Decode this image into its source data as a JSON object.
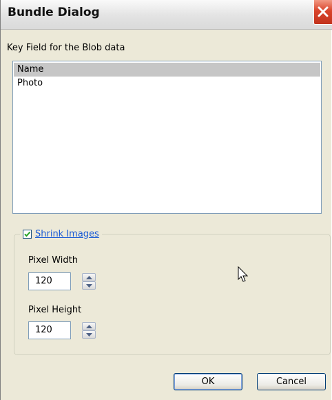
{
  "window": {
    "title": "Bundle Dialog"
  },
  "key_field": {
    "label": "Key Field for the Blob data",
    "items": [
      {
        "label": "Name",
        "selected": true
      },
      {
        "label": "Photo",
        "selected": false
      }
    ]
  },
  "shrink": {
    "label": "Shrink Images",
    "checked": true,
    "width_label": "Pixel Width",
    "width_value": "120",
    "height_label": "Pixel Height",
    "height_value": "120"
  },
  "buttons": {
    "ok": "OK",
    "cancel": "Cancel"
  },
  "colors": {
    "selection": "#c6c6c6",
    "link_blue": "#1a5bd6",
    "close_red": "#d9442b"
  }
}
